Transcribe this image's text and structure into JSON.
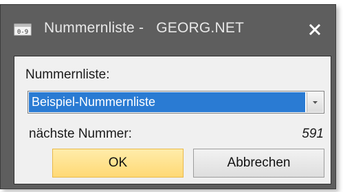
{
  "window": {
    "title": "Nummernliste -   GEORG.NET",
    "icon": "number-list-icon",
    "close_icon": "close-icon"
  },
  "form": {
    "list_label": "Nummernliste:",
    "list_selected": "Beispiel-Nummernliste",
    "next_number_label": "nächste Nummer:",
    "next_number_value": "591"
  },
  "buttons": {
    "ok_label": "OK",
    "cancel_label": "Abbrechen"
  },
  "colors": {
    "titlebar": "#5e5e5e",
    "selection": "#2a7bd3",
    "ok_button": "#ffd975"
  }
}
